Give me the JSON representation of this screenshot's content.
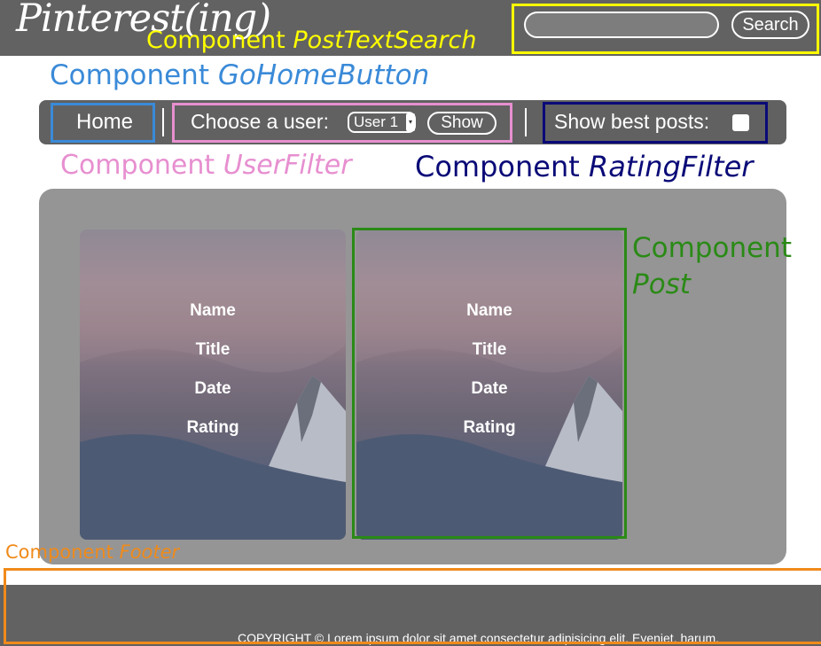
{
  "header": {
    "logo": "Pinterest(ing)",
    "search_placeholder": "",
    "search_button": "Search"
  },
  "nav": {
    "home": "Home",
    "user_label": "Choose a user:",
    "user_selected": "User 1",
    "show_button": "Show",
    "best_label": "Show best posts:",
    "best_checked": false
  },
  "posts": [
    {
      "name": "Name",
      "title": "Title",
      "date": "Date",
      "rating": "Rating"
    },
    {
      "name": "Name",
      "title": "Title",
      "date": "Date",
      "rating": "Rating"
    }
  ],
  "footer": {
    "copyright": "COPYRIGHT © Lorem ipsum dolor sit amet consectetur adipisicing elit. Eveniet, harum."
  },
  "annotations": {
    "search": {
      "prefix": "Component ",
      "name": "PostTextSearch",
      "color": "#ffff00"
    },
    "home": {
      "prefix": "Component ",
      "name": "GoHomeButton",
      "color": "#3a8ad8"
    },
    "user": {
      "prefix": "Component ",
      "name": "UserFilter",
      "color": "#e78fd0"
    },
    "rating": {
      "prefix": "Component ",
      "name": "RatingFilter",
      "color": "#0a0a78"
    },
    "post": {
      "prefix": "Component",
      "name": "Post",
      "color": "#2a8a16"
    },
    "footer": {
      "prefix": "Component ",
      "name": "Footer",
      "color": "#f08a1a"
    }
  }
}
